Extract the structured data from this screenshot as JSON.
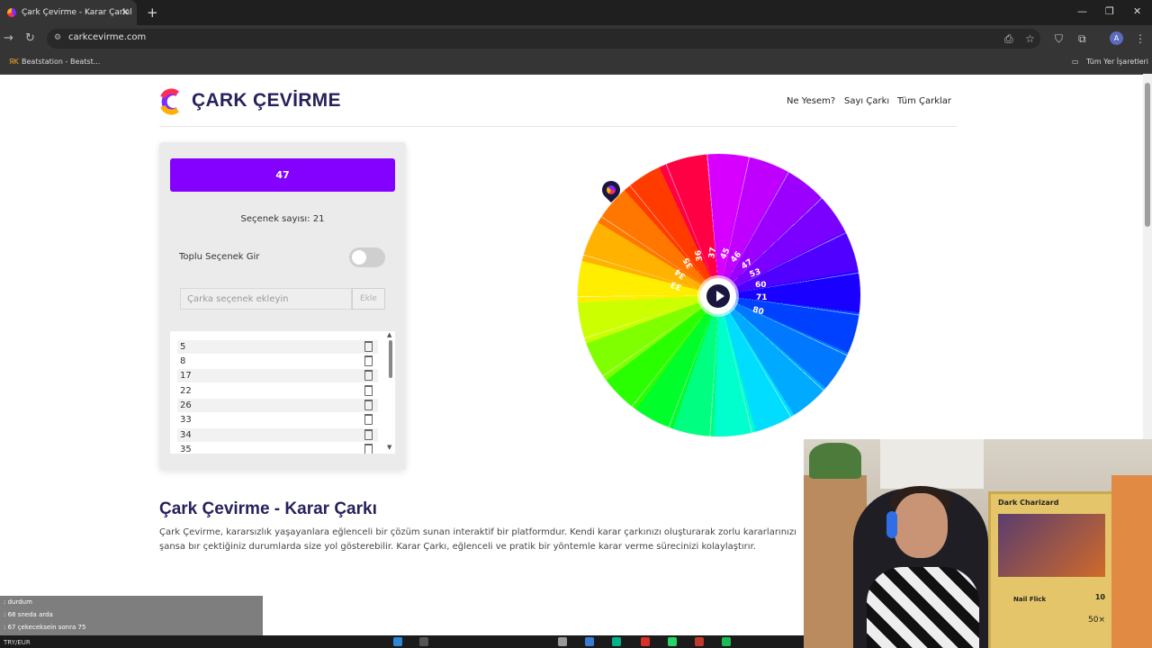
{
  "browser": {
    "tab_title": "Çark Çevirme - Karar Çarkıl",
    "url": "carkcevirme.com",
    "bookmark": "Beatstation - Beatst...",
    "bookmark_folder": "Tüm Yer İşaretleri",
    "avatar_letter": "A"
  },
  "site": {
    "brand": "ÇARK ÇEVİRME",
    "nav": [
      "Ne Yesem?",
      "Sayı Çarkı",
      "Tüm Çarklar"
    ]
  },
  "panel": {
    "result": "47",
    "count_text": "Seçenek sayısı: 21",
    "bulk_label": "Toplu Seçenek Gir",
    "input_placeholder": "Çarka seçenek ekleyin",
    "add_label": "Ekle",
    "options": [
      "5",
      "8",
      "17",
      "22",
      "26",
      "33",
      "34",
      "35"
    ]
  },
  "wheel": {
    "labels": [
      "37",
      "45",
      "46",
      "47",
      "53",
      "60",
      "71",
      "80",
      "36",
      "35",
      "34",
      "33"
    ]
  },
  "article": {
    "title": "Çark Çevirme - Karar Çarkı",
    "body": "Çark Çevirme, kararsızlık yaşayanlara eğlenceli bir çözüm sunan interaktif bir platformdur. Kendi karar çarkınızı oluşturarak zorlu kararlarınızı şansa bır çektiğiniz durumlarda size yol gösterebilir. Karar Çarkı, eğlenceli ve pratik bir yöntemle karar verme sürecinizi kolaylaştırır."
  },
  "webcam": {
    "card_title": "Dark Charizard",
    "card_attack": "Nail Flick",
    "card_hp": "10",
    "card_mult": "50×"
  },
  "chat": [
    {
      "user": "",
      "text": ": durdum"
    },
    {
      "user": "",
      "text": ": 68 sneda arda"
    },
    {
      "user": "",
      "text": ": 67 çekeceksein sonra 75"
    }
  ],
  "taskbar": {
    "left_text": "TRY/EUR"
  }
}
